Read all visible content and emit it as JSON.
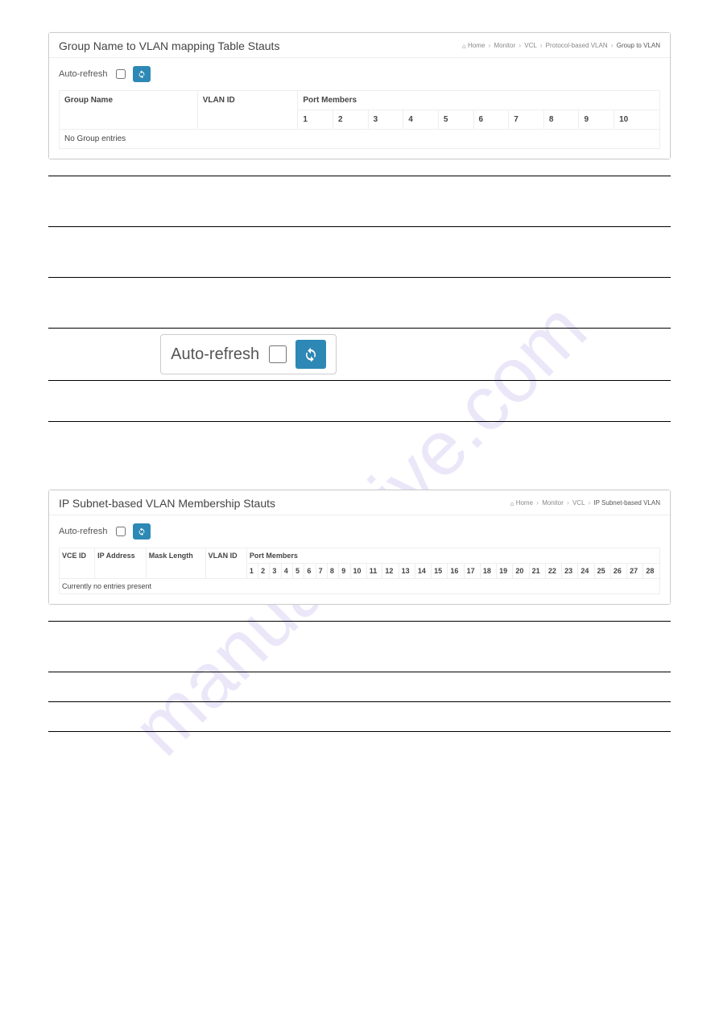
{
  "watermark": "manualshive.com",
  "panel1": {
    "title": "Group Name to VLAN mapping Table Stauts",
    "breadcrumb": [
      "Home",
      "Monitor",
      "VCL",
      "Protocol-based VLAN",
      "Group to VLAN"
    ],
    "autorefresh_label": "Auto-refresh",
    "table": {
      "col_group": "Group Name",
      "col_vlan": "VLAN ID",
      "port_members_label": "Port Members",
      "ports": [
        "1",
        "2",
        "3",
        "4",
        "5",
        "6",
        "7",
        "8",
        "9",
        "10"
      ],
      "empty_text": "No Group entries"
    }
  },
  "desc1": {
    "autorefresh_label": "Auto-refresh"
  },
  "panel2": {
    "title": "IP Subnet-based VLAN Membership Stauts",
    "breadcrumb": [
      "Home",
      "Monitor",
      "VCL",
      "IP Subnet-based VLAN"
    ],
    "autorefresh_label": "Auto-refresh",
    "table": {
      "col_vce": "VCE ID",
      "col_ip": "IP Address",
      "col_mask": "Mask Length",
      "col_vlan": "VLAN ID",
      "port_members_label": "Port Members",
      "ports": [
        "1",
        "2",
        "3",
        "4",
        "5",
        "6",
        "7",
        "8",
        "9",
        "10",
        "11",
        "12",
        "13",
        "14",
        "15",
        "16",
        "17",
        "18",
        "19",
        "20",
        "21",
        "22",
        "23",
        "24",
        "25",
        "26",
        "27",
        "28"
      ],
      "empty_text": "Currently no entries present"
    }
  }
}
